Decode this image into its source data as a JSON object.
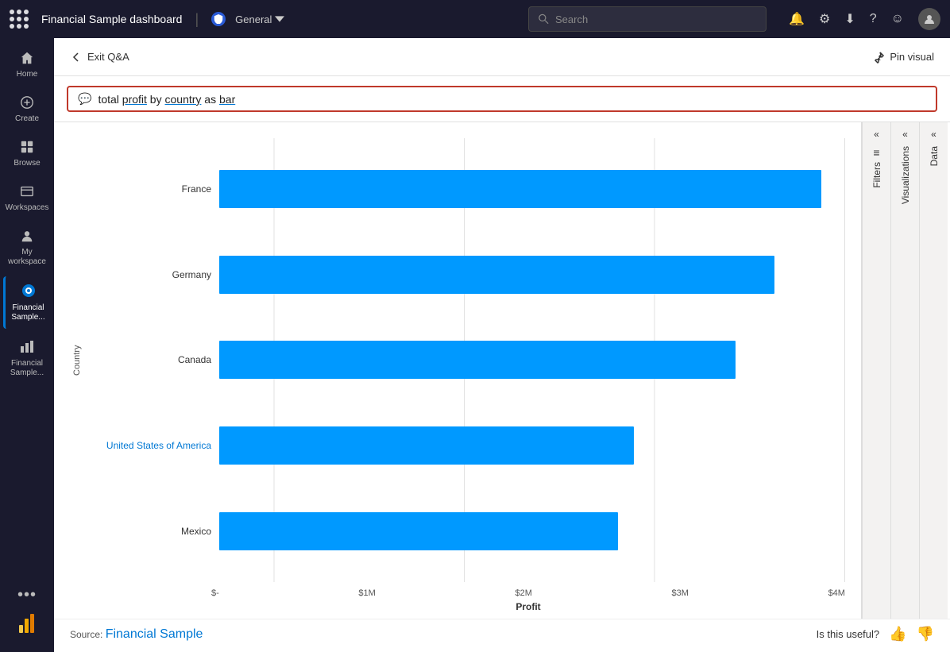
{
  "topnav": {
    "title": "Financial Sample  dashboard",
    "workspace": "General",
    "search_placeholder": "Search"
  },
  "header": {
    "exit_label": "Exit Q&A",
    "pin_label": "Pin visual"
  },
  "query": {
    "text": "total profit by country as bar",
    "icon": "💬"
  },
  "chart": {
    "y_axis_label": "Country",
    "x_axis_label": "Profit",
    "bars": [
      {
        "country": "France",
        "value": 3.85,
        "max": 4,
        "is_link": false
      },
      {
        "country": "Germany",
        "value": 3.55,
        "max": 4,
        "is_link": false
      },
      {
        "country": "Canada",
        "value": 3.3,
        "max": 4,
        "is_link": false
      },
      {
        "country": "United States of America",
        "value": 2.65,
        "max": 4,
        "is_link": true
      },
      {
        "country": "Mexico",
        "value": 2.55,
        "max": 4,
        "is_link": false
      }
    ],
    "x_ticks": [
      "$-",
      "$1M",
      "$2M",
      "$3M",
      "$4M"
    ]
  },
  "footer": {
    "source_prefix": "Source: ",
    "source_link_text": "Financial Sample",
    "feedback_label": "Is this useful?"
  },
  "sidebar": {
    "items": [
      {
        "label": "Home",
        "icon": "⌂"
      },
      {
        "label": "Create",
        "icon": "+"
      },
      {
        "label": "Browse",
        "icon": "⊞"
      },
      {
        "label": "Workspaces",
        "icon": "⬚"
      },
      {
        "label": "My workspace",
        "icon": "👤"
      },
      {
        "label": "Financial Sample...",
        "icon": "◉",
        "active": true
      },
      {
        "label": "Financial Sample...",
        "icon": "▦"
      }
    ]
  },
  "right_panels": [
    {
      "label": "Filters",
      "icon": "≡"
    },
    {
      "label": "Visualizations",
      "icon": ""
    },
    {
      "label": "Data",
      "icon": ""
    }
  ]
}
